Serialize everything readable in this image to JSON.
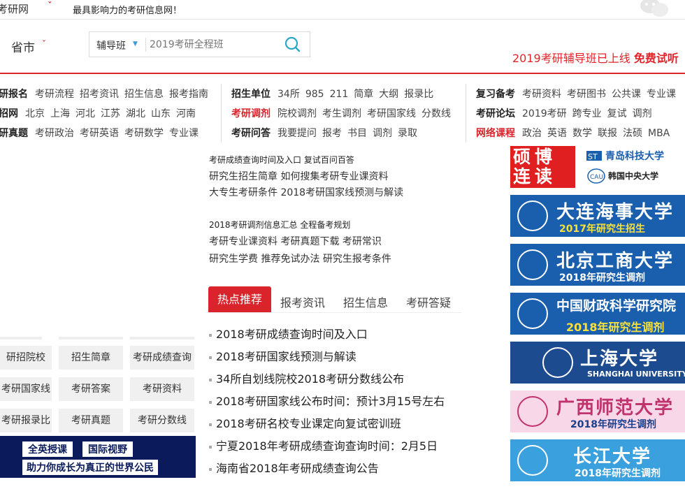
{
  "topbar": {
    "site_name": "考研网",
    "slogan": "最具影响力的考研信息网！"
  },
  "header": {
    "city_label": "省市",
    "search": {
      "category": "辅导班",
      "placeholder": "2019考研全程班"
    },
    "promo_text": "2019考研辅导班已上线",
    "promo_bold": "免费试听"
  },
  "nav": {
    "col1": [
      {
        "label": "研报名",
        "links": [
          "考研流程",
          "招考资讯",
          "招生信息",
          "报考指南"
        ]
      },
      {
        "label": "招网",
        "links": [
          "北京",
          "上海",
          "河北",
          "江苏",
          "湖北",
          "山东",
          "河南"
        ]
      },
      {
        "label": "研真题",
        "links": [
          "考研政治",
          "考研英语",
          "考研数学",
          "专业课"
        ]
      }
    ],
    "col2": [
      {
        "label": "招生单位",
        "links": [
          "34所",
          "985",
          "211",
          "简章",
          "大纲",
          "报录比"
        ]
      },
      {
        "label": "考研调剂",
        "links": [
          "院校调剂",
          "考生调剂",
          "考研国家线",
          "分数线"
        ]
      },
      {
        "label": "考研问答",
        "links": [
          "我要提问",
          "报考",
          "书目",
          "调剂",
          "录取"
        ]
      }
    ],
    "col3": [
      {
        "label": "复习备考",
        "links": [
          "考研资料",
          "考研图书",
          "公共课",
          "专业课"
        ]
      },
      {
        "label": "考研论坛",
        "links": [
          "2019考研",
          "跨专业",
          "复试",
          "调剂"
        ]
      },
      {
        "label": "网络课程",
        "links": [
          "政治",
          "英语",
          "数学",
          "联报",
          "法硕",
          "MBA"
        ]
      }
    ]
  },
  "mid_links": {
    "g1_small": [
      "考研成绩查询时间及入口",
      "复试百问百答"
    ],
    "g1_line2": [
      "研究生招生简章",
      "如何搜集考研专业课资料"
    ],
    "g1_line3": [
      "大专生考研条件",
      "2018考研国家线预测与解读"
    ],
    "g2_small": [
      "2018考研调剂信息汇总",
      "全程备考规划"
    ],
    "g2_line2": [
      "考研专业课资料",
      "考研真题下载",
      "考研常识"
    ],
    "g2_line3": [
      "研究生学费",
      "推荐免试办法",
      "研究生报考条件"
    ]
  },
  "tabs": [
    "热点推荐",
    "报考资讯",
    "招生信息",
    "考研答疑"
  ],
  "news": [
    "2018考研成绩查询时间及入口",
    "2018考研国家线预测与解读",
    "34所自划线院校2018考研分数线公布",
    "2018考研国家线公布时间：预计3月15号左右",
    "2018考研名校专业课定向复试密训班",
    "宁夏2018年考研成绩查询查询时间：2月5日",
    "海南省2018年考研成绩查询公告"
  ],
  "left_grid": [
    [
      "研招院校",
      "招生简章",
      "考研成绩查询"
    ],
    [
      "考研国家线",
      "考研答案",
      "考研资料"
    ],
    [
      "考研报录比",
      "考研真题",
      "考研分数线"
    ]
  ],
  "left_banner": {
    "tag1": "全英授课",
    "tag2": "国际视野",
    "tag3": "助力你成长为真正的世界公民"
  },
  "ads": [
    {
      "title": "硕博连读",
      "univ1": "青岛科技大学",
      "univ2": "韩国中央大学"
    },
    {
      "name": "大连海事大学",
      "sub": "2017年研究生招生"
    },
    {
      "name": "北京工商大学",
      "sub": "2018年研究生调剂"
    },
    {
      "name": "中国财政科学研究院",
      "sub": "2018年研究生调剂"
    },
    {
      "name": "上海大学",
      "sub": "SHANGHAI UNIVERSITY"
    },
    {
      "name": "广西师范大学",
      "sub": "2018年研究生调剂"
    },
    {
      "name": "长江大学",
      "sub": "2018年研究生调剂"
    }
  ],
  "colors": {
    "brand_red": "#d9242c",
    "ad_blue": "#1a5fae",
    "banner_navy": "#0a1a5a"
  }
}
